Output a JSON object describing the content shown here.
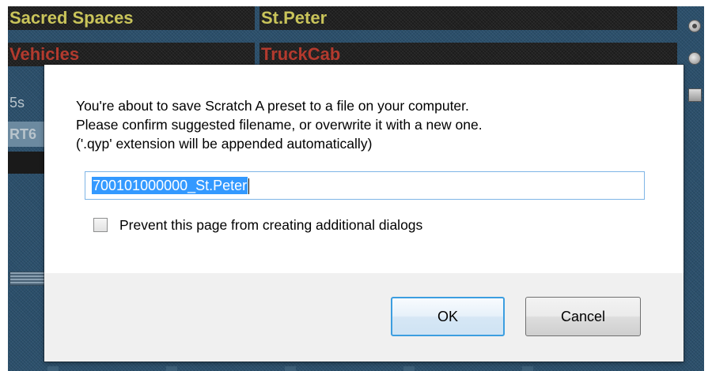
{
  "background": {
    "cells": [
      {
        "text": "Sacred Spaces"
      },
      {
        "text": "St.Peter"
      },
      {
        "text": "Vehicles"
      },
      {
        "text": "TruckCab"
      }
    ],
    "labels": {
      "duration": "5s",
      "row_code": "RT6"
    },
    "colors": {
      "panel_blue": "#2b4f6b",
      "category_yellow": "#c9c45a",
      "category_red": "#b33a2e"
    }
  },
  "dialog": {
    "message_lines": [
      "You're about to save Scratch A preset to a file on your computer.",
      "Please confirm suggested filename, or overwrite it with a new one.",
      "('.qyp' extension will be appended automatically)"
    ],
    "filename_value": "700101000000_St.Peter",
    "checkbox": {
      "checked": false,
      "label": "Prevent this page from creating additional dialogs"
    },
    "buttons": {
      "ok": "OK",
      "cancel": "Cancel"
    },
    "colors": {
      "selection": "#3399ff",
      "focus_border": "#3c9ee0",
      "footer_bg": "#f0f0f0"
    }
  }
}
